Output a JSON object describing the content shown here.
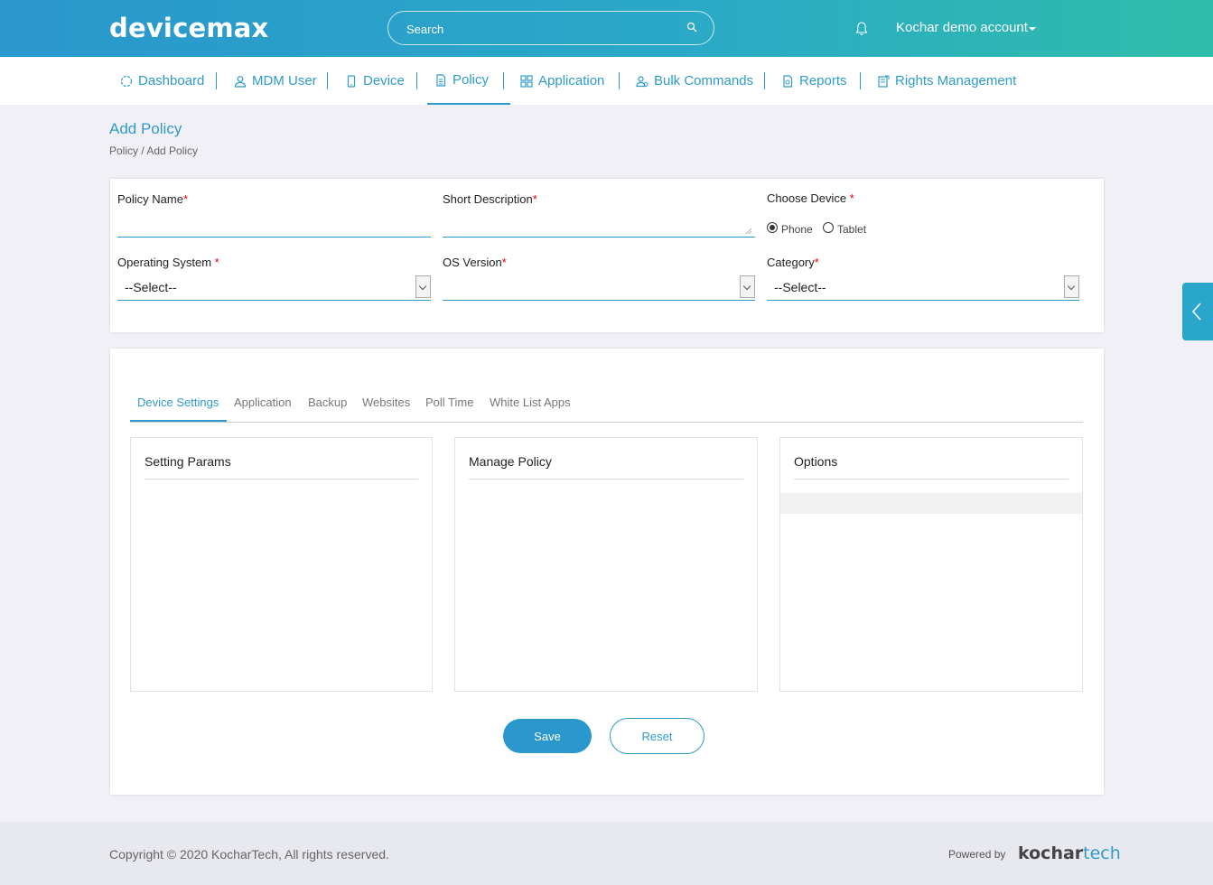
{
  "header": {
    "logo": "devicemax",
    "search_placeholder": "Search",
    "account": "Kochar demo account"
  },
  "nav": {
    "items": [
      {
        "label": "Dashboard",
        "icon": "dashboard-icon"
      },
      {
        "label": "MDM User",
        "icon": "user-icon"
      },
      {
        "label": "Device",
        "icon": "phone-icon"
      },
      {
        "label": "Policy",
        "icon": "document-icon",
        "active": true
      },
      {
        "label": "Application",
        "icon": "grid-icon"
      },
      {
        "label": "Bulk Commands",
        "icon": "users-icon"
      },
      {
        "label": "Reports",
        "icon": "report-icon"
      },
      {
        "label": "Rights Management",
        "icon": "rights-icon"
      }
    ]
  },
  "page": {
    "title": "Add Policy",
    "breadcrumb": "Policy / Add Policy"
  },
  "form": {
    "policy_name_label": "Policy Name",
    "short_description_label": "Short Description",
    "choose_device_label": "Choose Device ",
    "device_options": [
      "Phone",
      "Tablet"
    ],
    "device_selected": "Phone",
    "os_label": "Operating System ",
    "os_value": "--Select--",
    "os_version_label": "OS Version",
    "os_version_value": "",
    "category_label": "Category",
    "category_value": "--Select--",
    "required_mark": "*"
  },
  "tabs": {
    "items": [
      "Device Settings",
      "Application",
      "Backup",
      "Websites",
      "Poll Time",
      "White List Apps"
    ],
    "active": "Device Settings"
  },
  "panels": {
    "setting_params": "Setting Params",
    "manage_policy": "Manage Policy",
    "options": "Options"
  },
  "actions": {
    "save": "Save",
    "reset": "Reset"
  },
  "footer": {
    "copyright": "Copyright © 2020 KocharTech, All rights reserved.",
    "powered_by": "Powered by",
    "brand_part1": "kochar",
    "brand_part2": "tech"
  },
  "colors": {
    "accent": "#2f9bcb",
    "header_start": "#2a97cd",
    "header_end": "#2ebda9",
    "required": "#e00000"
  }
}
